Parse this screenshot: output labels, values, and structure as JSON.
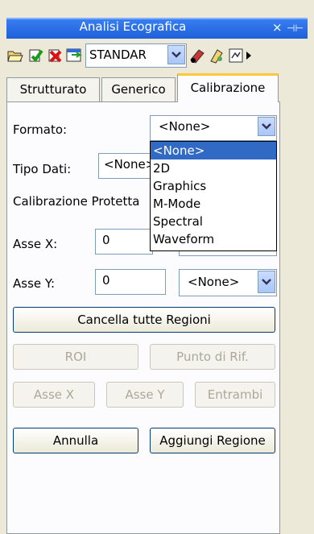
{
  "window": {
    "title": "Analisi Ecografica",
    "close_glyph": "×",
    "pin_glyph": "⊣⊢"
  },
  "toolbar": {
    "icons": [
      "open-folder-icon",
      "add-green-icon",
      "remove-red-icon",
      "export-icon",
      "measure-icon",
      "settings-icon",
      "edit-icon",
      "more-icon"
    ],
    "preset_value": "STANDAR"
  },
  "tabs": [
    {
      "label": "Strutturato",
      "active": false
    },
    {
      "label": "Generico",
      "active": false
    },
    {
      "label": "Calibrazione",
      "active": true
    }
  ],
  "form": {
    "formato_label": "Formato:",
    "formato_value": "<None>",
    "tipo_dati_label": "Tipo Dati:",
    "tipo_dati_value": "<None>",
    "calibrazione_protetta_label": "Calibrazione Protetta",
    "asse_x_label": "Asse X:",
    "asse_x_value": "0",
    "asse_y_label": "Asse Y:",
    "asse_y_value": "0",
    "asse_y_unit": "<None>"
  },
  "dropdown_options": [
    "<None>",
    "2D",
    "Graphics",
    "M-Mode",
    "Spectral",
    "Waveform"
  ],
  "buttons": {
    "cancella_tutte": "Cancella tutte Regioni",
    "roi": "ROI",
    "punto_rif": "Punto di Rif.",
    "asse_x": "Asse X",
    "asse_y": "Asse Y",
    "entrambi": "Entrambi",
    "annulla": "Annulla",
    "aggiungi": "Aggiungi Regione"
  },
  "colors": {
    "title_bar": "#2a6ae4",
    "selection": "#316ac5",
    "tab_highlight": "#ffc83c"
  }
}
